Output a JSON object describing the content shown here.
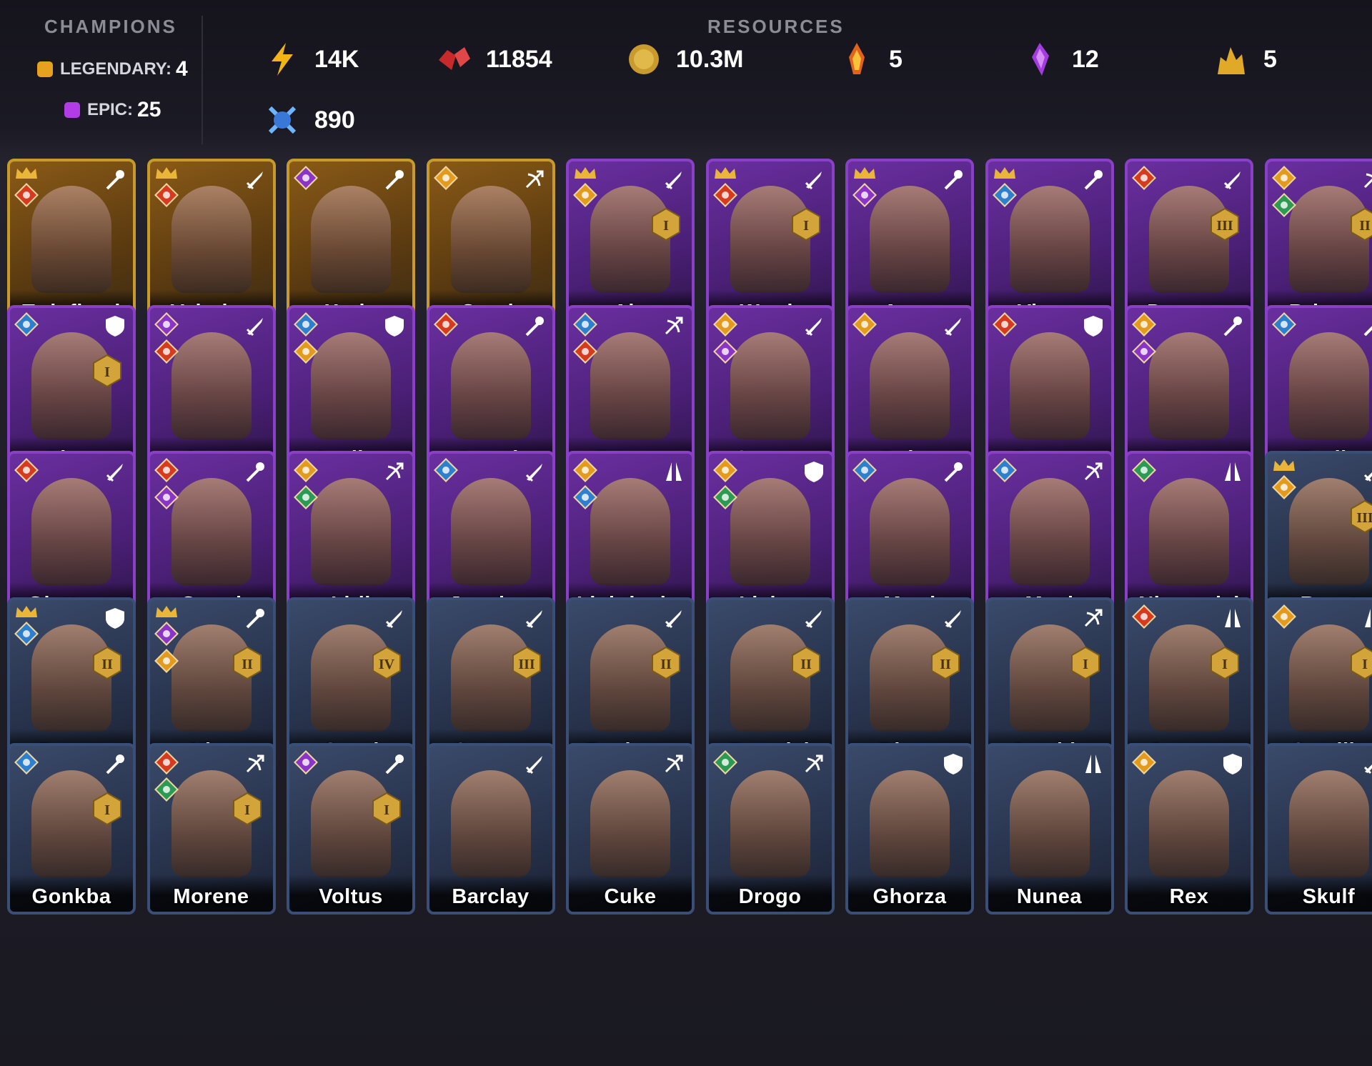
{
  "header": {
    "champions_title": "CHAMPIONS",
    "legendary_label": "LEGENDARY:",
    "legendary_count": "4",
    "epic_label": "EPIC:",
    "epic_count": "25",
    "resources_title": "RESOURCES",
    "resources": [
      {
        "icon": "energy-icon",
        "value": "14K"
      },
      {
        "icon": "ruby-gems-icon",
        "value": "11854"
      },
      {
        "icon": "silver-coin-icon",
        "value": "10.3M"
      },
      {
        "icon": "fire-shard-icon",
        "value": "5"
      },
      {
        "icon": "void-crystal-icon",
        "value": "12"
      },
      {
        "icon": "gold-pile-icon",
        "value": "5"
      },
      {
        "icon": "arena-token-icon",
        "value": "890"
      }
    ]
  },
  "colors": {
    "legendary": "#c79a2c",
    "epic": "#8a3fc7",
    "rare": "#3a4f78"
  },
  "champions": [
    {
      "name": "Twinfiend",
      "rarity": "legendary",
      "crown": true,
      "affinities": [
        "force"
      ],
      "role": "magic-icon",
      "rank": ""
    },
    {
      "name": "Valeriya",
      "rarity": "legendary",
      "crown": true,
      "affinities": [
        "force"
      ],
      "role": "sword-icon",
      "rank": ""
    },
    {
      "name": "Xaris",
      "rarity": "legendary",
      "crown": false,
      "affinities": [
        "void"
      ],
      "role": "magic-icon",
      "rank": ""
    },
    {
      "name": "Crach",
      "rarity": "legendary",
      "crown": false,
      "affinities": [
        "spirit"
      ],
      "role": "bow-icon",
      "rank": ""
    },
    {
      "name": "Ain",
      "rarity": "epic",
      "crown": true,
      "affinities": [
        "spirit"
      ],
      "role": "sword-icon",
      "rank": "I"
    },
    {
      "name": "Wrath",
      "rarity": "epic",
      "crown": true,
      "affinities": [
        "force"
      ],
      "role": "sword-icon",
      "rank": "I"
    },
    {
      "name": "Aeon",
      "rarity": "epic",
      "crown": true,
      "affinities": [
        "void"
      ],
      "role": "magic-icon",
      "rank": ""
    },
    {
      "name": "Vixera",
      "rarity": "epic",
      "crown": true,
      "affinities": [
        "magic"
      ],
      "role": "magic-icon",
      "rank": ""
    },
    {
      "name": "Daemon",
      "rarity": "epic",
      "crown": false,
      "affinities": [
        "force"
      ],
      "role": "sword-icon",
      "rank": "III"
    },
    {
      "name": "Brienne",
      "rarity": "epic",
      "crown": false,
      "affinities": [
        "spirit",
        "nature"
      ],
      "role": "bow-icon",
      "rank": "II"
    },
    {
      "name": "Rhox",
      "rarity": "epic",
      "crown": false,
      "affinities": [
        "magic"
      ],
      "role": "shield-icon",
      "rank": "I"
    },
    {
      "name": "Atrox",
      "rarity": "epic",
      "crown": false,
      "affinities": [
        "void",
        "force"
      ],
      "role": "sword-icon",
      "rank": ""
    },
    {
      "name": "Aveline",
      "rarity": "epic",
      "crown": false,
      "affinities": [
        "magic",
        "spirit"
      ],
      "role": "shield-icon",
      "rank": ""
    },
    {
      "name": "Azzoth",
      "rarity": "epic",
      "crown": false,
      "affinities": [
        "force"
      ],
      "role": "magic-icon",
      "rank": ""
    },
    {
      "name": "Brunor",
      "rarity": "epic",
      "crown": false,
      "affinities": [
        "magic",
        "force"
      ],
      "role": "bow-icon",
      "rank": ""
    },
    {
      "name": "Cyrene",
      "rarity": "epic",
      "crown": false,
      "affinities": [
        "spirit",
        "void"
      ],
      "role": "sword-icon",
      "rank": ""
    },
    {
      "name": "Dalyn",
      "rarity": "epic",
      "crown": false,
      "affinities": [
        "spirit"
      ],
      "role": "sword-icon",
      "rank": ""
    },
    {
      "name": "Drayga",
      "rarity": "epic",
      "crown": false,
      "affinities": [
        "force"
      ],
      "role": "shield-icon",
      "rank": ""
    },
    {
      "name": "Eona",
      "rarity": "epic",
      "crown": false,
      "affinities": [
        "spirit",
        "void"
      ],
      "role": "magic-icon",
      "rank": ""
    },
    {
      "name": "Faelin",
      "rarity": "epic",
      "crown": false,
      "affinities": [
        "magic"
      ],
      "role": "magic-icon",
      "rank": ""
    },
    {
      "name": "Gluttony",
      "rarity": "epic",
      "crown": false,
      "affinities": [
        "force"
      ],
      "role": "sword-icon",
      "rank": ""
    },
    {
      "name": "Greed",
      "rarity": "epic",
      "crown": false,
      "affinities": [
        "force",
        "void"
      ],
      "role": "magic-icon",
      "rank": ""
    },
    {
      "name": "Idril",
      "rarity": "epic",
      "crown": false,
      "affinities": [
        "spirit",
        "nature"
      ],
      "role": "bow-icon",
      "rank": ""
    },
    {
      "name": "Janqhar",
      "rarity": "epic",
      "crown": false,
      "affinities": [
        "magic"
      ],
      "role": "sword-icon",
      "rank": ""
    },
    {
      "name": "Lightlocke",
      "rarity": "epic",
      "crown": false,
      "affinities": [
        "spirit",
        "magic"
      ],
      "role": "prayer-icon",
      "rank": ""
    },
    {
      "name": "Livian",
      "rarity": "epic",
      "crown": false,
      "affinities": [
        "spirit",
        "nature"
      ],
      "role": "shield-icon",
      "rank": ""
    },
    {
      "name": "Marri",
      "rarity": "epic",
      "crown": false,
      "affinities": [
        "magic"
      ],
      "role": "magic-icon",
      "rank": ""
    },
    {
      "name": "Maul",
      "rarity": "epic",
      "crown": false,
      "affinities": [
        "magic"
      ],
      "role": "bow-icon",
      "rank": ""
    },
    {
      "name": "Nissandei",
      "rarity": "epic",
      "crown": false,
      "affinities": [
        "nature"
      ],
      "role": "prayer-icon",
      "rank": ""
    },
    {
      "name": "Borut",
      "rarity": "rare",
      "crown": true,
      "affinities": [
        "spirit"
      ],
      "role": "sword-icon",
      "rank": "III"
    },
    {
      "name": "Dagna",
      "rarity": "rare",
      "crown": true,
      "affinities": [
        "magic"
      ],
      "role": "shield-icon",
      "rank": "II"
    },
    {
      "name": "Niro",
      "rarity": "rare",
      "crown": true,
      "affinities": [
        "void",
        "spirit"
      ],
      "role": "magic-icon",
      "rank": "II"
    },
    {
      "name": "Ogrul",
      "rarity": "rare",
      "crown": false,
      "affinities": [],
      "role": "sword-icon",
      "rank": "IV"
    },
    {
      "name": "Gogran",
      "rarity": "rare",
      "crown": false,
      "affinities": [],
      "role": "sword-icon",
      "rank": "III"
    },
    {
      "name": "Decimus",
      "rarity": "rare",
      "crown": false,
      "affinities": [],
      "role": "sword-icon",
      "rank": "II"
    },
    {
      "name": "Duradel",
      "rarity": "rare",
      "crown": false,
      "affinities": [],
      "role": "sword-icon",
      "rank": "II"
    },
    {
      "name": "Rhutu",
      "rarity": "rare",
      "crown": false,
      "affinities": [],
      "role": "sword-icon",
      "rank": "II"
    },
    {
      "name": "Amahle",
      "rarity": "rare",
      "crown": false,
      "affinities": [],
      "role": "bow-icon",
      "rank": "I"
    },
    {
      "name": "Autumn",
      "rarity": "rare",
      "crown": false,
      "affinities": [
        "force"
      ],
      "role": "prayer-icon",
      "rank": "I"
    },
    {
      "name": "Camille",
      "rarity": "rare",
      "crown": false,
      "affinities": [
        "spirit"
      ],
      "role": "prayer-icon",
      "rank": "I"
    },
    {
      "name": "Gonkba",
      "rarity": "rare",
      "crown": false,
      "affinities": [
        "magic"
      ],
      "role": "magic-icon",
      "rank": "I"
    },
    {
      "name": "Morene",
      "rarity": "rare",
      "crown": false,
      "affinities": [
        "force",
        "nature"
      ],
      "role": "bow-icon",
      "rank": "I"
    },
    {
      "name": "Voltus",
      "rarity": "rare",
      "crown": false,
      "affinities": [
        "void"
      ],
      "role": "magic-icon",
      "rank": "I"
    },
    {
      "name": "Barclay",
      "rarity": "rare",
      "crown": false,
      "affinities": [],
      "role": "sword-icon",
      "rank": ""
    },
    {
      "name": "Cuke",
      "rarity": "rare",
      "crown": false,
      "affinities": [],
      "role": "bow-icon",
      "rank": ""
    },
    {
      "name": "Drogo",
      "rarity": "rare",
      "crown": false,
      "affinities": [
        "nature"
      ],
      "role": "bow-icon",
      "rank": ""
    },
    {
      "name": "Ghorza",
      "rarity": "rare",
      "crown": false,
      "affinities": [],
      "role": "shield-icon",
      "rank": ""
    },
    {
      "name": "Nunea",
      "rarity": "rare",
      "crown": false,
      "affinities": [],
      "role": "prayer-icon",
      "rank": ""
    },
    {
      "name": "Rex",
      "rarity": "rare",
      "crown": false,
      "affinities": [
        "spirit"
      ],
      "role": "shield-icon",
      "rank": ""
    },
    {
      "name": "Skulf",
      "rarity": "rare",
      "crown": false,
      "affinities": [],
      "role": "sword-icon",
      "rank": ""
    }
  ]
}
